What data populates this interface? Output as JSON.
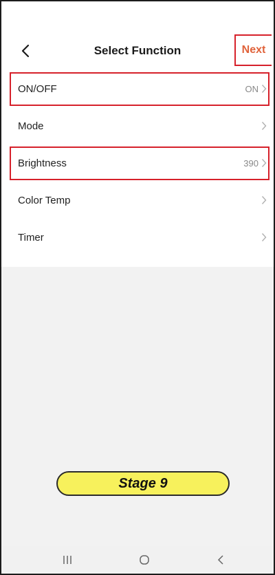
{
  "header": {
    "title": "Select Function",
    "next_label": "Next"
  },
  "functions": [
    {
      "label": "ON/OFF",
      "value": "ON"
    },
    {
      "label": "Mode",
      "value": ""
    },
    {
      "label": "Brightness",
      "value": "390"
    },
    {
      "label": "Color Temp",
      "value": ""
    },
    {
      "label": "Timer",
      "value": ""
    }
  ],
  "overlay": {
    "stage_label": "Stage 9"
  },
  "colors": {
    "accent": "#e0623a",
    "highlight": "#d6202a",
    "badge": "#f7f15c"
  },
  "icons": {
    "back": "chevron-left-icon",
    "row": "chevron-right-icon",
    "nav_recents": "recents-icon",
    "nav_home": "home-icon",
    "nav_back": "back-icon"
  }
}
